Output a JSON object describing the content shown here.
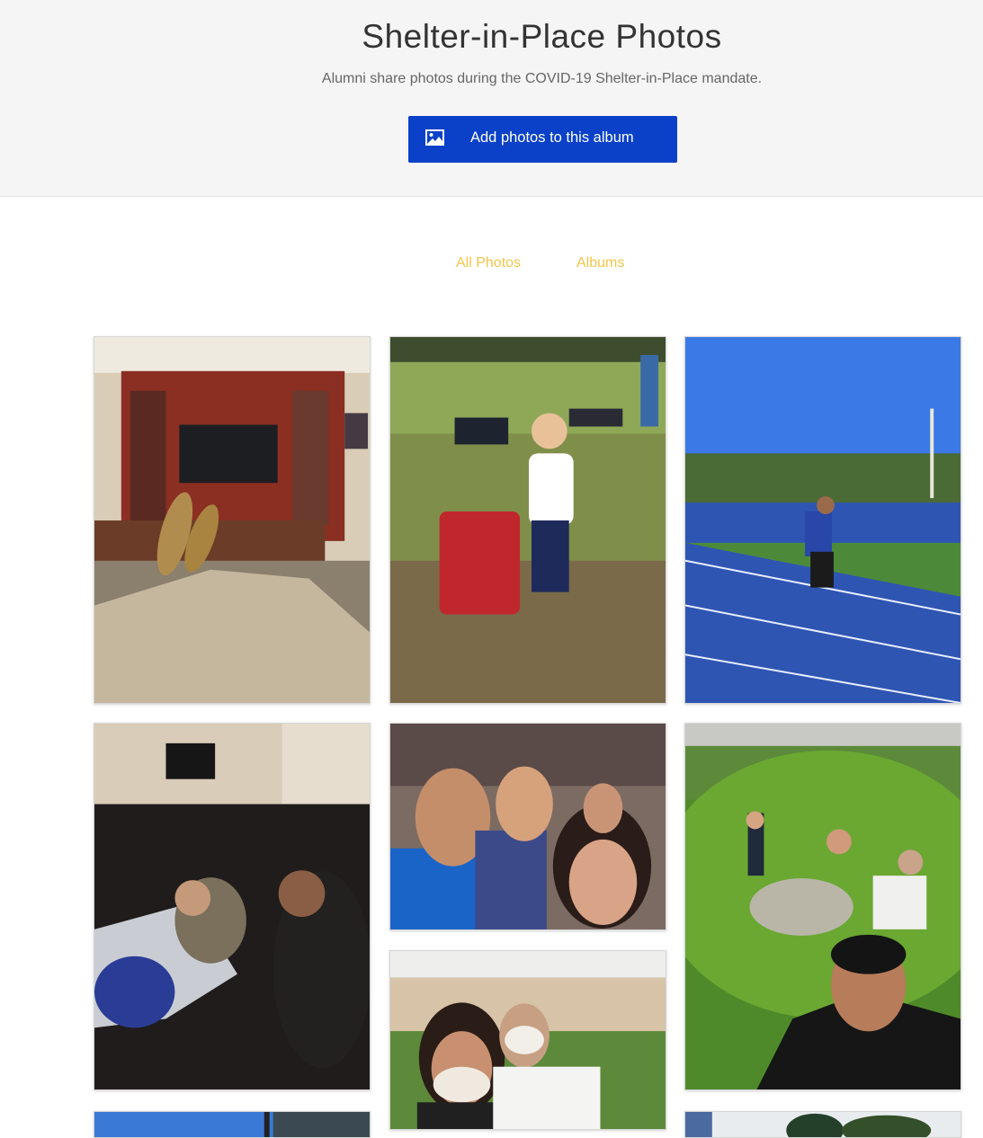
{
  "header": {
    "title": "Shelter-in-Place Photos",
    "subtitle": "Alumni share photos during the COVID-19 Shelter-in-Place mandate.",
    "add_button_label": "Add photos to this album",
    "add_button_icon": "image-icon",
    "button_color": "#0a41c8"
  },
  "tabs": [
    {
      "label": "All Photos"
    },
    {
      "label": "Albums"
    }
  ],
  "accent_color": "#f2c64a",
  "photos": [
    {
      "subject": "living-room-feet-up"
    },
    {
      "subject": "girl-softball-bag"
    },
    {
      "subject": "man-running-track"
    },
    {
      "subject": "child-man-sleeping-couch"
    },
    {
      "subject": "group-selfie"
    },
    {
      "subject": "family-picnic-selfie"
    },
    {
      "subject": "couple-masks-cart"
    },
    {
      "subject": "sky-partial"
    },
    {
      "subject": "trees-partial"
    }
  ]
}
